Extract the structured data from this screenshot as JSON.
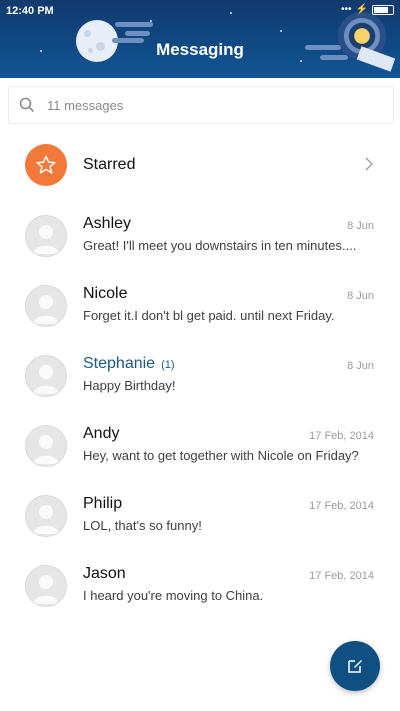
{
  "status_bar": {
    "time": "12:40 PM",
    "icons": [
      "dots-icon",
      "wifi-icon",
      "battery-icon"
    ]
  },
  "header": {
    "title": "Messaging"
  },
  "search": {
    "text": "11 messages",
    "icon": "search-icon"
  },
  "starred": {
    "label": "Starred",
    "icon": "star-icon",
    "color": "#f3793a"
  },
  "conversations": [
    {
      "name": "Ashley",
      "date": "8 Jun",
      "preview": "Great! I'll meet you downstairs in ten minutes....",
      "unread": ""
    },
    {
      "name": "Nicole",
      "date": "8 Jun",
      "preview": "Forget it.I don't bl get paid. until next Friday.",
      "unread": ""
    },
    {
      "name": "Stephanie",
      "date": "8 Jun",
      "preview": "Happy Birthday!",
      "unread": "(1)"
    },
    {
      "name": "Andy",
      "date": "17 Feb, 2014",
      "preview": "Hey, want to get together with Nicole on Friday?",
      "unread": ""
    },
    {
      "name": "Philip",
      "date": "17 Feb, 2014",
      "preview": "LOL, that's so funny!",
      "unread": ""
    },
    {
      "name": "Jason",
      "date": "17 Feb, 2014",
      "preview": "I heard you're moving to China.",
      "unread": ""
    }
  ],
  "compose": {
    "icon": "compose-icon",
    "color": "#0f4f82"
  },
  "colors": {
    "header": "#0f4a85",
    "accent": "#1a5a8a"
  }
}
